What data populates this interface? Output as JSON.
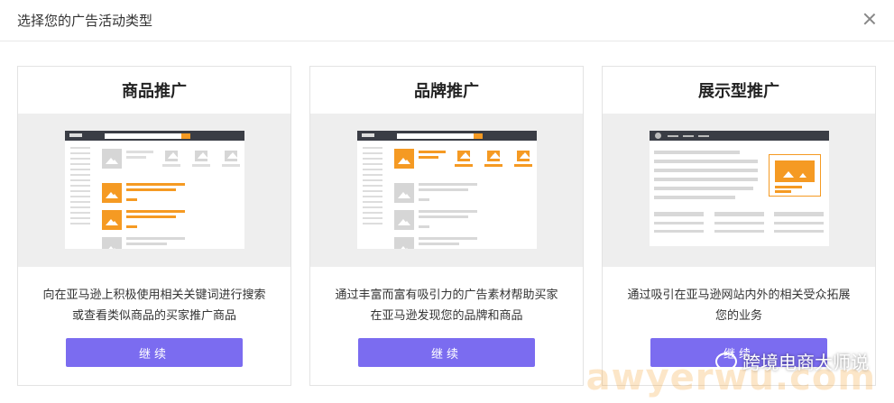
{
  "dialog": {
    "title": "选择您的广告活动类型"
  },
  "cards": [
    {
      "title": "商品推广",
      "description": "向在亚马逊上积极使用相关关键词进行搜索或查看类似商品的买家推广商品",
      "button": "继续"
    },
    {
      "title": "品牌推广",
      "description": "通过丰富而富有吸引力的广告素材帮助买家在亚马逊发现您的品牌和商品",
      "button": "继续"
    },
    {
      "title": "展示型推广",
      "description": "通过吸引在亚马逊网站内外的相关受众拓展您的业务",
      "button": "继续"
    }
  ],
  "watermark": {
    "text": "跨境电商大师说",
    "url": "awyerwu.com"
  },
  "colors": {
    "accent": "#7b6cf0",
    "preview_orange": "#f59a23",
    "preview_bg": "#eeeeee"
  },
  "icons": [
    "close-icon",
    "image-placeholder-icon",
    "wechat-icon"
  ]
}
